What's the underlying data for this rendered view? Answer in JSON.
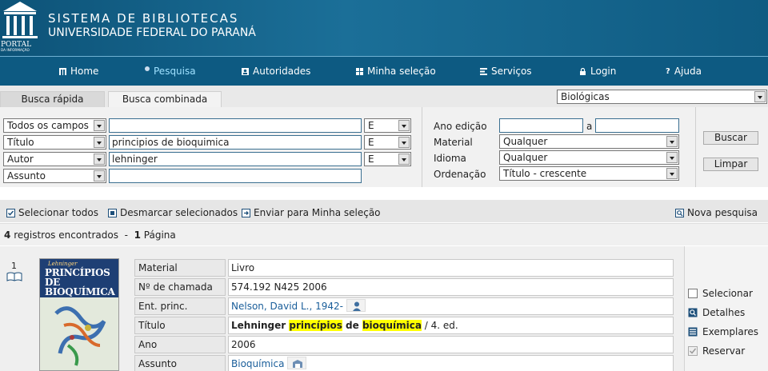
{
  "header": {
    "logo_text": "PORTAL",
    "logo_subtext": "DA INFORMAÇÃO",
    "title_line1": "SISTEMA DE BIBLIOTECAS",
    "title_line2": "UNIVERSIDADE FEDERAL DO PARANÁ"
  },
  "nav": {
    "items": [
      {
        "label": "Home",
        "icon": "home-icon"
      },
      {
        "label": "Pesquisa",
        "icon": "dot-icon",
        "active": true
      },
      {
        "label": "Autoridades",
        "icon": "person-card-icon"
      },
      {
        "label": "Minha seleção",
        "icon": "grid-icon"
      },
      {
        "label": "Serviços",
        "icon": "services-icon"
      },
      {
        "label": "Login",
        "icon": "lock-icon"
      },
      {
        "label": "Ajuda",
        "icon": "question-icon"
      }
    ]
  },
  "tabs": {
    "rapida": "Busca rápida",
    "combinada": "Busca combinada",
    "library_select": "Biológicas"
  },
  "search": {
    "rows": [
      {
        "field": "Todos os campos",
        "value": "",
        "op": "E"
      },
      {
        "field": "Título",
        "value": "principios de bioquimica",
        "op": "E"
      },
      {
        "field": "Autor",
        "value": "lehninger",
        "op": "E"
      },
      {
        "field": "Assunto",
        "value": ""
      }
    ],
    "ano_label": "Ano edição",
    "ano_from": "",
    "ano_sep": "a",
    "ano_to": "",
    "material_label": "Material",
    "material_value": "Qualquer",
    "idioma_label": "Idioma",
    "idioma_value": "Qualquer",
    "ordenacao_label": "Ordenação",
    "ordenacao_value": "Título - crescente",
    "buscar": "Buscar",
    "limpar": "Limpar"
  },
  "toolbar": {
    "select_all": "Selecionar todos",
    "deselect": "Desmarcar selecionados",
    "send": "Enviar para Minha seleção",
    "new_search": "Nova pesquisa"
  },
  "results": {
    "count": "4",
    "count_text": "registros encontrados",
    "dash": "-",
    "pages": "1",
    "pages_text": "Página"
  },
  "record": {
    "number": "1",
    "cover_brand": "Lehninger",
    "cover_title_1": "PRINCÍPIOS DE",
    "cover_title_2": "BIOQUÍMICA",
    "fields": [
      {
        "label": "Material",
        "value": "Livro"
      },
      {
        "label": "Nº de chamada",
        "value": "574.192 N425 2006"
      },
      {
        "label": "Ent. princ.",
        "value": "Nelson, David L., 1942-"
      },
      {
        "label": "Título",
        "value_parts": [
          "Lehninger",
          " ",
          "princípios",
          " de ",
          "bioquímica",
          " / 4. ed."
        ]
      },
      {
        "label": "Ano",
        "value": "2006"
      },
      {
        "label": "Assunto",
        "value": "Bioquímica"
      }
    ],
    "actions": {
      "selecionar": "Selecionar",
      "detalhes": "Detalhes",
      "exemplares": "Exemplares",
      "reservar": "Reservar"
    }
  },
  "colors": {
    "header_blue": "#0d5a82",
    "highlight": "#ffff00",
    "link": "#1a5e9a"
  }
}
